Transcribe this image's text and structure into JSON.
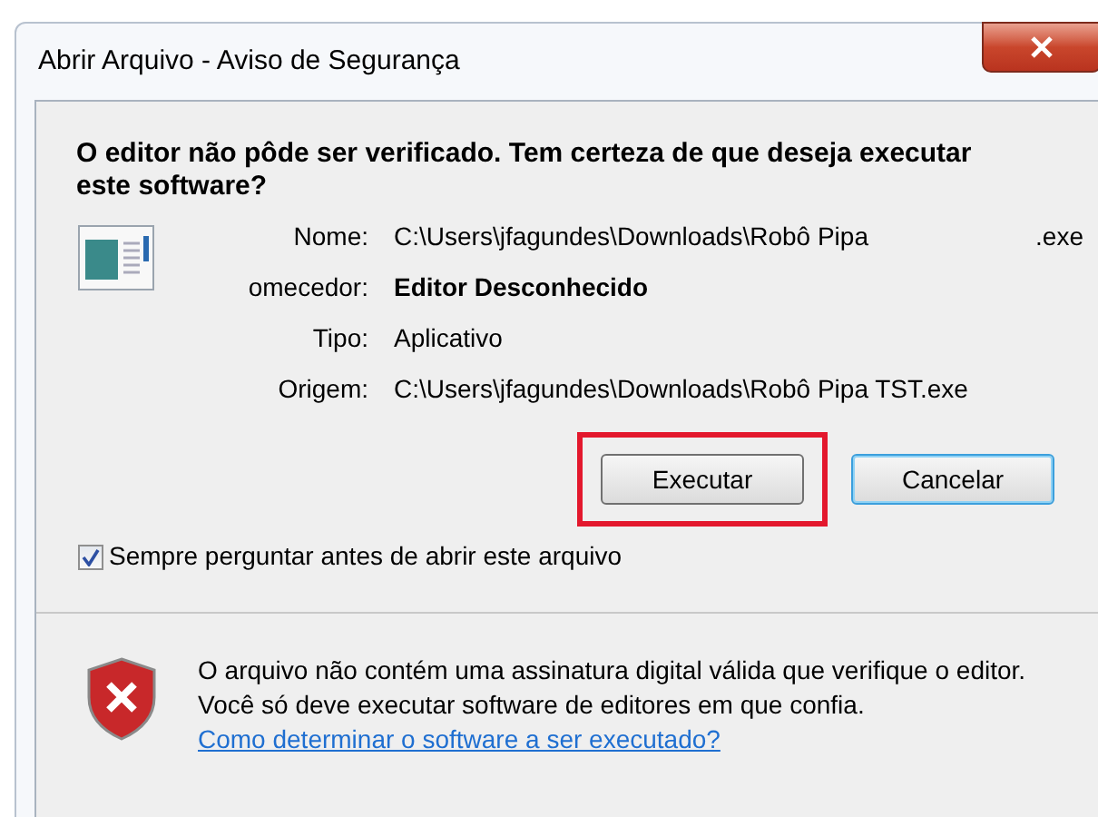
{
  "window": {
    "title": "Abrir Arquivo - Aviso de Segurança"
  },
  "question": "O editor não pôde ser verificado. Tem certeza de que deseja executar este software?",
  "details": [
    {
      "label": "Nome:",
      "value": "C:\\Users\\jfagundes\\Downloads\\Robô Pipa",
      "suffix": ".exe",
      "bold": false
    },
    {
      "label": "omecedor:",
      "value": "Editor Desconhecido",
      "bold": true
    },
    {
      "label": "Tipo:",
      "value": "Aplicativo",
      "bold": false
    },
    {
      "label": "Origem:",
      "value": "C:\\Users\\jfagundes\\Downloads\\Robô Pipa TST.exe",
      "bold": false
    }
  ],
  "buttons": [
    {
      "label": "Executar",
      "highlighted": true,
      "default": false
    },
    {
      "label": "Cancelar",
      "highlighted": false,
      "default": true
    }
  ],
  "checkbox": {
    "label": "Sempre perguntar antes de abrir este arquivo",
    "checked": true
  },
  "warning": {
    "text": "O arquivo não contém uma assinatura digital válida que verifique o editor. Você só deve executar software de editores em que confia.",
    "link": "Como determinar o software a ser executado?"
  }
}
